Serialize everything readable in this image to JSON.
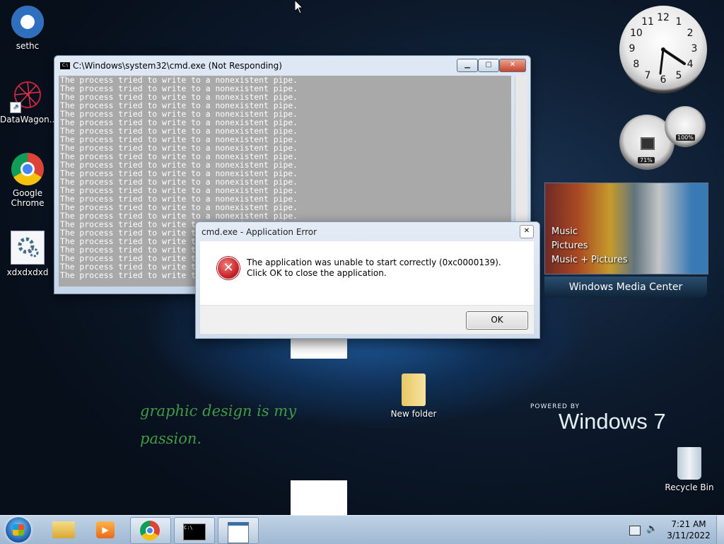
{
  "desktop": {
    "icons": [
      {
        "label": "sethc"
      },
      {
        "label": "DataWagon..."
      },
      {
        "label": "Google Chrome"
      },
      {
        "label": "xdxdxdxd"
      },
      {
        "label": "New folder"
      },
      {
        "label": "Recycle Bin"
      }
    ],
    "wallpaper_text": {
      "line1": "graphic design is my",
      "line2": "passion."
    },
    "branding": {
      "powered_by": "POWERED BY",
      "windows": "Windows 7"
    }
  },
  "cmd_window": {
    "title": "C:\\Windows\\system32\\cmd.exe (Not Responding)",
    "icon_text": "C:\\",
    "line_text": "The process tried to write to a nonexistent pipe.",
    "line_count": 24
  },
  "error_dialog": {
    "title": "cmd.exe - Application Error",
    "message": "The application was unable to start correctly (0xc0000139). Click OK to close the application.",
    "ok_label": "OK"
  },
  "gadgets": {
    "clock": {
      "numbers": [
        "12",
        "1",
        "2",
        "3",
        "4",
        "5",
        "6",
        "7",
        "8",
        "9",
        "10",
        "11"
      ]
    },
    "cpu_meter": {
      "cpu_percent": "71%",
      "memory_percent": "100%"
    },
    "media_center": {
      "menu": [
        "Music",
        "Pictures",
        "Music + Pictures"
      ],
      "title": "Windows Media Center"
    }
  },
  "taskbar": {
    "time": "7:21 AM",
    "date": "3/11/2022"
  },
  "colors": {
    "wallpaper_text": "#3f9b47",
    "taskbar": "#b3c8de",
    "error_red": "#c8262a"
  }
}
